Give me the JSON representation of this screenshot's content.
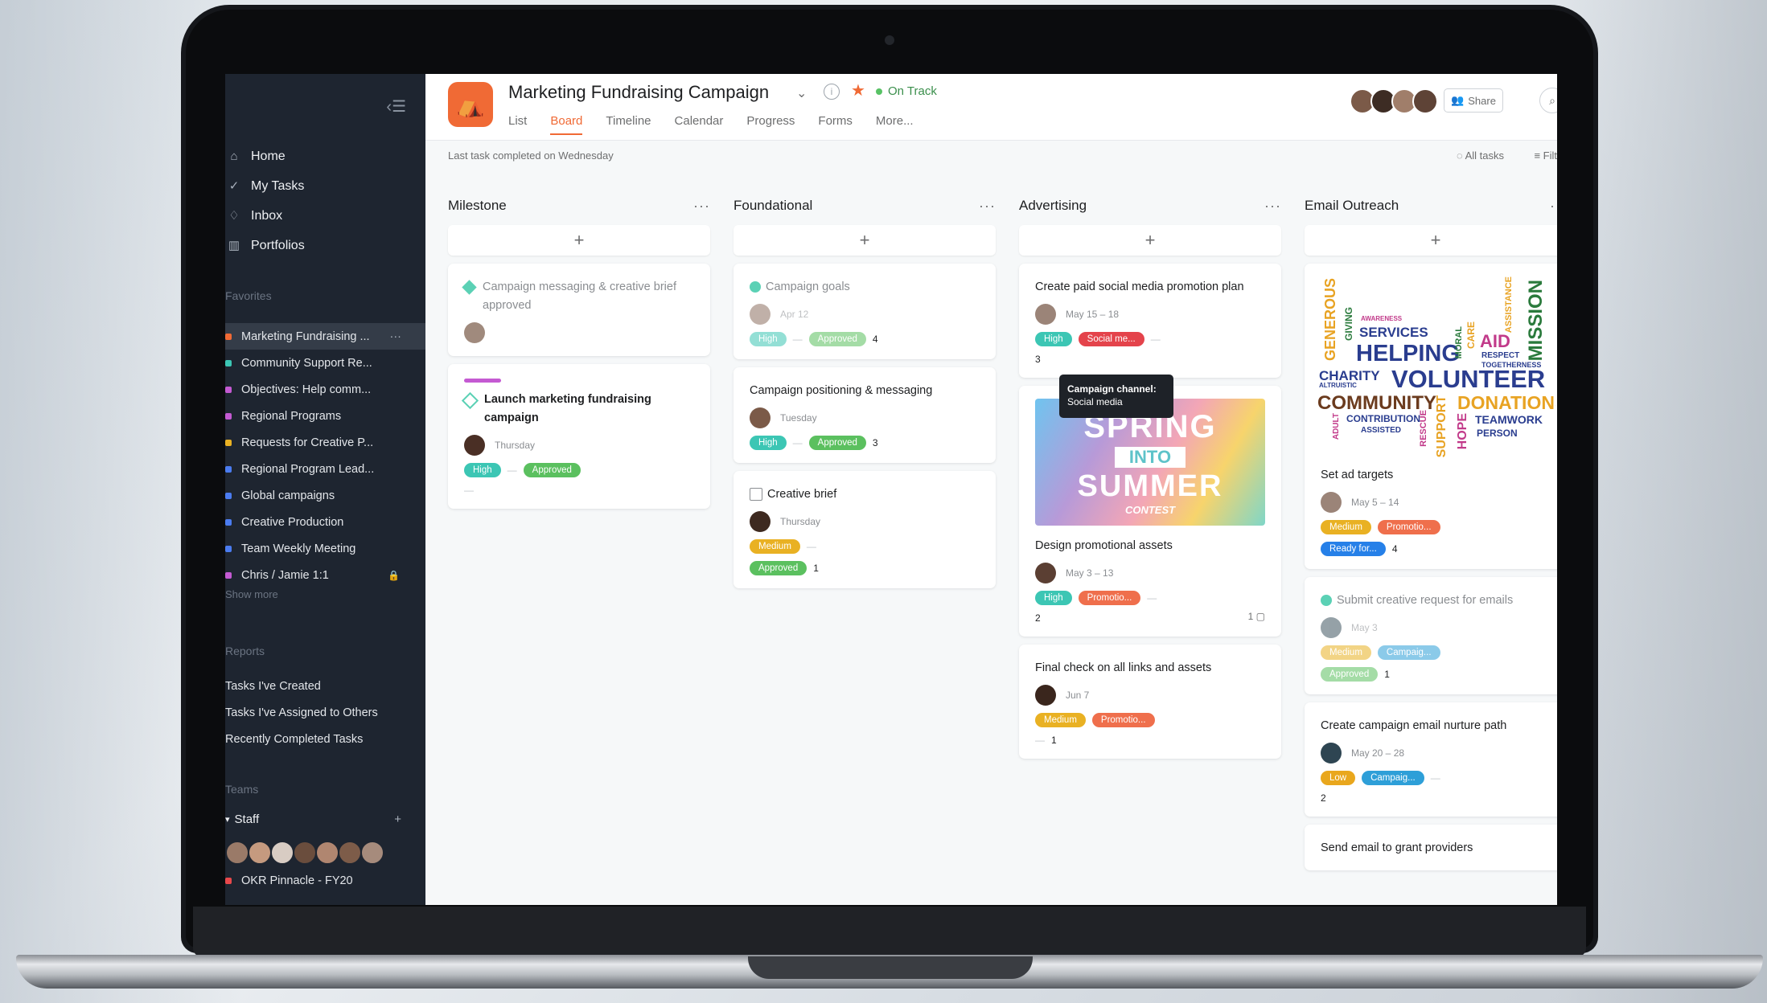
{
  "sidebar": {
    "nav": [
      {
        "label": "Home",
        "icon": "home-icon"
      },
      {
        "label": "My Tasks",
        "icon": "check-circle-icon"
      },
      {
        "label": "Inbox",
        "icon": "bell-icon"
      },
      {
        "label": "Portfolios",
        "icon": "bar-chart-icon"
      }
    ],
    "favorites_title": "Favorites",
    "favorites": [
      {
        "label": "Marketing Fundraising ...",
        "color": "#f06a35"
      },
      {
        "label": "Community Support Re...",
        "color": "#3cc6b4"
      },
      {
        "label": "Objectives: Help comm...",
        "color": "#c45ad2"
      },
      {
        "label": "Regional Programs",
        "color": "#c45ad2"
      },
      {
        "label": "Requests for Creative P...",
        "color": "#e9b123"
      },
      {
        "label": "Regional Program Lead...",
        "color": "#4b7cf0"
      },
      {
        "label": "Global campaigns",
        "color": "#4b7cf0"
      },
      {
        "label": "Creative Production",
        "color": "#4b7cf0"
      },
      {
        "label": "Team Weekly Meeting",
        "color": "#4b7cf0"
      },
      {
        "label": "Chris / Jamie 1:1",
        "color": "#c45ad2"
      }
    ],
    "show_more": "Show more",
    "reports_title": "Reports",
    "reports": [
      "Tasks I've Created",
      "Tasks I've Assigned to Others",
      "Recently Completed Tasks"
    ],
    "teams_title": "Teams",
    "team_name": "Staff",
    "okr": "OKR Pinnacle - FY20"
  },
  "header": {
    "title": "Marketing Fundraising Campaign",
    "status": "On Track",
    "tabs": [
      "List",
      "Board",
      "Timeline",
      "Calendar",
      "Progress",
      "Forms",
      "More..."
    ],
    "share": "Share",
    "last_task": "Last task completed on Wednesday",
    "all_tasks": "All tasks",
    "filter": "Filt"
  },
  "columns": [
    {
      "title": "Milestone"
    },
    {
      "title": "Foundational"
    },
    {
      "title": "Advertising"
    },
    {
      "title": "Email Outreach"
    }
  ],
  "cards": {
    "m1": {
      "title": "Campaign messaging & creative brief approved"
    },
    "m2": {
      "title": "Launch marketing fundraising campaign",
      "date": "Thursday",
      "tag1": "High",
      "tag2": "Approved"
    },
    "f1": {
      "title": "Campaign goals",
      "date": "Apr 12",
      "tag1": "High",
      "tag2": "Approved",
      "count": "4"
    },
    "f2": {
      "title": "Campaign positioning & messaging",
      "date": "Tuesday",
      "tag1": "High",
      "tag2": "Approved",
      "count": "3"
    },
    "f3": {
      "title": "Creative brief",
      "date": "Thursday",
      "tag1": "Medium",
      "tag2": "Approved",
      "count": "1"
    },
    "a1": {
      "title": "Create paid social media promotion plan",
      "date": "May 15 – 18",
      "tag1": "High",
      "tag2": "Social me...",
      "count": "3",
      "tooltip_title": "Campaign channel:",
      "tooltip_value": "Social media"
    },
    "a2": {
      "title": "Design promotional assets",
      "date": "May 3 – 13",
      "tag1": "High",
      "tag2": "Promotio...",
      "count": "2",
      "comments": "1",
      "img_l1": "SPRING",
      "img_l2": "INTO",
      "img_l3": "SUMMER",
      "img_l4": "CONTEST"
    },
    "a3": {
      "title": "Final check on all links and assets",
      "date": "Jun 7",
      "tag1": "Medium",
      "tag2": "Promotio...",
      "count": "1"
    },
    "e1": {
      "title": "Set ad targets",
      "date": "May 5 – 14",
      "tag1": "Medium",
      "tag2": "Promotio...",
      "tag3": "Ready for...",
      "count": "4",
      "words": [
        "GENEROUS",
        "GIVING",
        "SERVICES",
        "HELPING",
        "AID",
        "MISSION",
        "CHARITY",
        "VOLUNTEER",
        "COMMUNITY",
        "DONATIONS",
        "TEAMWORK",
        "HOPE",
        "SUPPORT",
        "ASSISTANCE",
        "CARE",
        "RESPECT",
        "TOGETHERNESS",
        "PERSON",
        "CONTRIBUTION",
        "ASSISTED",
        "RESCUE",
        "MORAL",
        "ALTRUISTIC",
        "ADULT",
        "AWARENESS"
      ]
    },
    "e2": {
      "title": "Submit creative request for emails",
      "date": "May 3",
      "tag1": "Medium",
      "tag2": "Campaig...",
      "tag3": "Approved",
      "count": "1"
    },
    "e3": {
      "title": "Create campaign email nurture path",
      "date": "May 20 – 28",
      "tag1": "Low",
      "tag2": "Campaig...",
      "count": "2"
    },
    "e4": {
      "title": "Send email to grant providers"
    }
  }
}
